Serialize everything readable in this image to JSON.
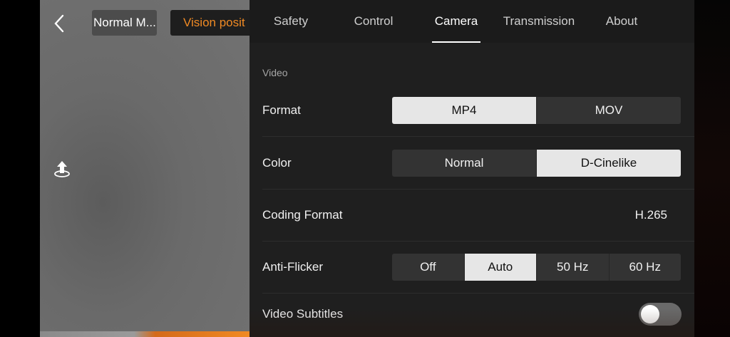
{
  "camera": {
    "mode_label": "Normal M...",
    "vision_label": "Vision posit"
  },
  "tabs": [
    {
      "label": "Safety",
      "active": false
    },
    {
      "label": "Control",
      "active": false
    },
    {
      "label": "Camera",
      "active": true
    },
    {
      "label": "Transmission",
      "active": false
    },
    {
      "label": "About",
      "active": false
    }
  ],
  "settings": {
    "section_title": "Video",
    "format": {
      "label": "Format",
      "options": [
        "MP4",
        "MOV"
      ],
      "selected": "MP4"
    },
    "color": {
      "label": "Color",
      "options": [
        "Normal",
        "D-Cinelike"
      ],
      "selected": "D-Cinelike"
    },
    "coding_format": {
      "label": "Coding Format",
      "value": "H.265"
    },
    "anti_flicker": {
      "label": "Anti-Flicker",
      "options": [
        "Off",
        "Auto",
        "50 Hz",
        "60 Hz"
      ],
      "selected": "Auto"
    },
    "video_subtitles": {
      "label": "Video Subtitles",
      "enabled": false
    }
  },
  "colors": {
    "accent_orange": "#f08a24",
    "panel_bg": "#1f1f1f",
    "selected_segment": "#e6e6e6"
  }
}
